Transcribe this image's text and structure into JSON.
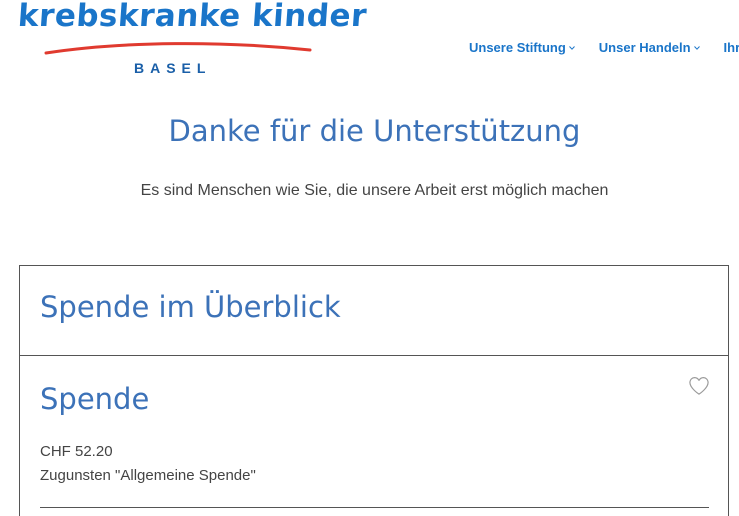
{
  "header": {
    "logo": {
      "wordmark": "krebskranke kinder",
      "city": "BASEL",
      "wordmark_color": "#1a75c9",
      "swoosh_color": "#e03a2f",
      "city_color": "#1a5fa8"
    },
    "nav": {
      "items": [
        {
          "label": "Unsere Stiftung",
          "icon": "chevron-down-icon"
        },
        {
          "label": "Unser Handeln",
          "icon": "chevron-down-icon"
        },
        {
          "label": "Ihr"
        }
      ]
    }
  },
  "hero": {
    "title": "Danke für die Unterstützung",
    "subtitle": "Es sind Menschen wie Sie, die unsere Arbeit erst möglich machen"
  },
  "summary": {
    "title": "Spende im Überblick",
    "item": {
      "title": "Spende",
      "amount": "CHF 52.20",
      "purpose": "Zugunsten \"Allgemeine Spende\"",
      "favorite_icon": "heart-outline-icon"
    }
  },
  "colors": {
    "accent": "#1a75c9",
    "heading": "#3c72b8",
    "text": "#444444",
    "border": "#555555"
  }
}
